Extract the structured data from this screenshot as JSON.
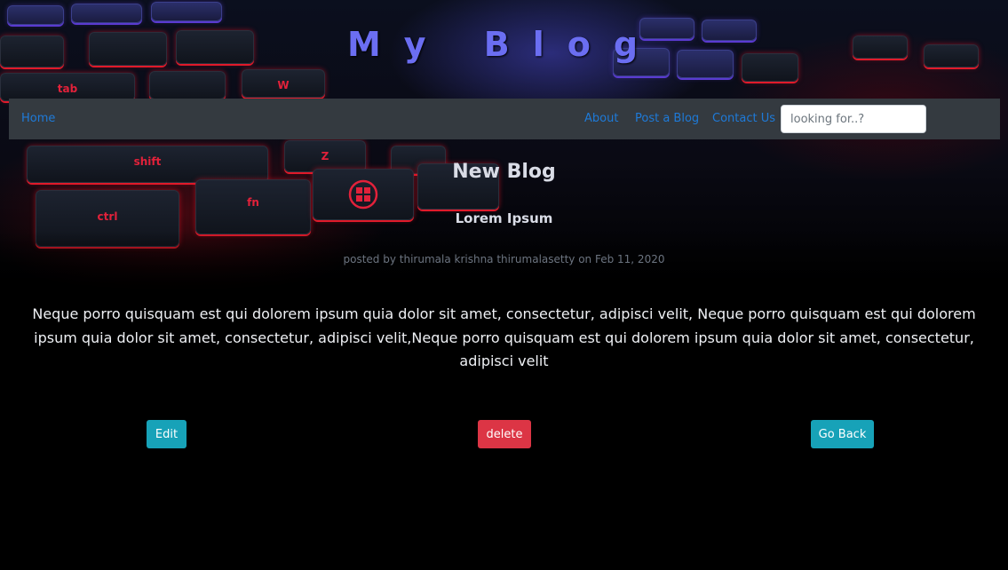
{
  "header": {
    "site_title": "My Blog"
  },
  "navbar": {
    "home_label": "Home",
    "about_label": "About",
    "post_label": "Post a Blog",
    "contact_label": "Contact Us",
    "search_placeholder": "looking for..?"
  },
  "hero_keys": {
    "tab": "tab",
    "shift": "shift",
    "ctrl": "ctrl",
    "fn": "fn",
    "w": "W",
    "z": "Z"
  },
  "post": {
    "title": "New Blog",
    "subtitle": "Lorem Ipsum",
    "meta": "posted by thirumala krishna thirumalasetty on Feb 11, 2020",
    "body": "Neque porro quisquam est qui dolorem ipsum quia dolor sit amet, consectetur, adipisci velit, Neque porro quisquam est qui dolorem ipsum quia dolor sit amet, consectetur, adipisci velit,Neque porro quisquam est qui dolorem ipsum quia dolor sit amet, consectetur, adipisci velit"
  },
  "actions": {
    "edit_label": "Edit",
    "delete_label": "delete",
    "back_label": "Go Back"
  },
  "colors": {
    "navbar_bg": "#343a40",
    "link": "#1e7ad8",
    "title": "#6b6ef2",
    "info": "#17a2b8",
    "danger": "#dc3545"
  }
}
